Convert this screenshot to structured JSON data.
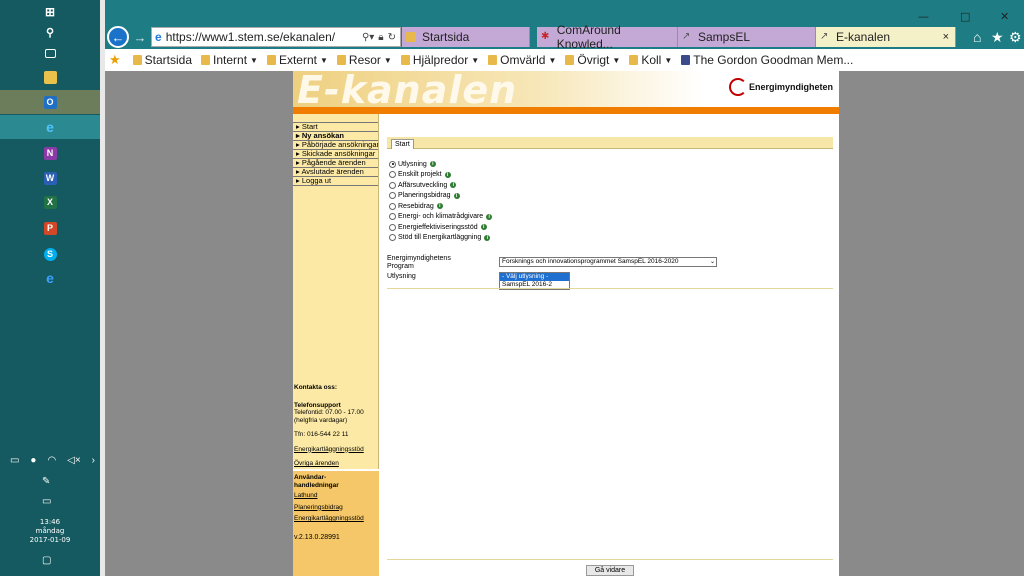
{
  "taskbar": {
    "clock_time": "13:46",
    "clock_day": "måndag",
    "clock_date": "2017-01-09",
    "icons": [
      "windows-icon",
      "search-icon",
      "task-view-icon",
      "file-explorer-icon",
      "outlook-icon",
      "internet-explorer-icon",
      "onenote-icon",
      "word-icon",
      "excel-icon",
      "powerpoint-icon",
      "skype-icon",
      "edge-icon"
    ]
  },
  "browser": {
    "address": "https://www1.stem.se/ekanalen/",
    "tabs": [
      {
        "title": "Startsida",
        "color": "#c4a9d6"
      },
      {
        "title": "ComAround Knowled...",
        "color": "#c4a9d6"
      },
      {
        "title": "SampsEL",
        "color": "#c4a9d6"
      },
      {
        "title": "E-kanalen",
        "color": "#f4f0c8",
        "active": true
      }
    ],
    "close_tab": "×",
    "favorites": [
      "Startsida",
      "Internt",
      "Externt",
      "Resor",
      "Hjälpredor",
      "Omvärld",
      "Övrigt",
      "Koll",
      "The Gordon Goodman Mem..."
    ]
  },
  "site": {
    "banner_title": "E-kanalen",
    "logo_text": "Energimyndigheten",
    "menu": [
      "Start",
      "Ny ansökan",
      "Påbörjade ansökningar",
      "Skickade ansökningar",
      "Pågående ärenden",
      "Avslutade ärenden",
      "Logga ut"
    ],
    "contact": {
      "heading": "Kontakta oss:",
      "support_heading": "Telefonsupport",
      "hours": "Telefontid: 07.00 - 17.00",
      "hours_note": "(helgfria vardagar)",
      "phone": "Tfn: 016-544 22 11",
      "link1": "Energikartläggningsstöd",
      "link2": "Övriga ärenden"
    },
    "guides": {
      "heading1": "Användar-",
      "heading2": "handledningar",
      "link1": "Lathund",
      "link2": "Planeringsbidrag",
      "link3": "Energikartläggningsstöd"
    },
    "version": "v.2.13.0.28991",
    "tab_label": "Start",
    "radios": [
      {
        "label": "Utlysning",
        "checked": true
      },
      {
        "label": "Enskilt projekt",
        "checked": false
      },
      {
        "label": "Affärsutveckling",
        "checked": false
      },
      {
        "label": "Planeringsbidrag",
        "checked": false
      },
      {
        "label": "Resebidrag",
        "checked": false
      },
      {
        "label": "Energi- och klimatrådgivare",
        "checked": false
      },
      {
        "label": "Energieffektiviseringsstöd",
        "checked": false
      },
      {
        "label": "Stöd till Energikartläggning",
        "checked": false
      }
    ],
    "program_label_1": "Energimyndighetens",
    "program_label_2": "Program",
    "program_value": "Forsknings och innovationsprogrammet SamspEL 2016-2020",
    "utlysning_label": "Utlysning",
    "utlysning_options": [
      "- Välj utlysning -",
      "SamspEL 2016-2"
    ],
    "go_button": "Gå vidare"
  }
}
